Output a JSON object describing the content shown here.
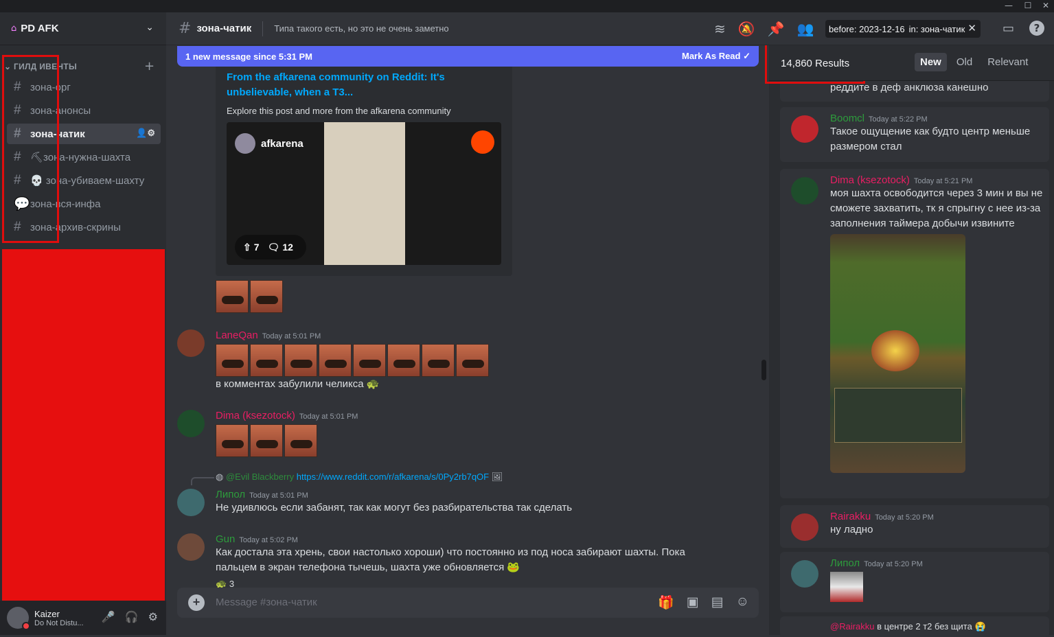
{
  "server": {
    "name": "PD AFK"
  },
  "category": {
    "label": "ГИЛД ИВЕНТЫ"
  },
  "channels": [
    {
      "label": "зона-орг"
    },
    {
      "label": "зона-анонсы"
    },
    {
      "label": "зона-чатик"
    },
    {
      "label": "⛏зона-нужна-шахта"
    },
    {
      "label": "💀 зона-убиваем-шахту"
    },
    {
      "label": "зона-вся-инфа"
    },
    {
      "label": "зона-архив-скрины"
    }
  ],
  "user": {
    "name": "Kaizer",
    "status": "Do Not Distu..."
  },
  "header": {
    "channel": "зона-чатик",
    "topic": "Типа такого есть, но это не очень заметно"
  },
  "search": {
    "token1": "before: 2023-12-16",
    "token2": "in: зона-чатик"
  },
  "new_messages": {
    "text": "1 new message since 5:31 PM",
    "action": "Mark As Read"
  },
  "embed": {
    "title": "From the afkarena community on Reddit: It's unbelievable, when a T3...",
    "description": "Explore this post and more from the afkarena community",
    "subreddit": "afkarena",
    "upvotes": "7",
    "comments": "12"
  },
  "messages": [
    {
      "author": "LaneQan",
      "time": "Today at 5:01 PM",
      "text": "в комментах забулили челикса 🐢",
      "color": "#e91e63"
    },
    {
      "author": "Dima (ksezotock)",
      "time": "Today at 5:01 PM",
      "text": "",
      "color": "#e91e63"
    },
    {
      "reply_author": "@Evil Blackberry",
      "reply_link": "https://www.reddit.com/r/afkarena/s/0Py2rb7qOF",
      "author": "Липол",
      "time": "Today at 5:01 PM",
      "text": "Не удивлюсь если забанят, так как могут без разбирательства так сделать",
      "color": "#2d9c3c"
    },
    {
      "author": "Gun",
      "time": "Today at 5:02 PM",
      "text": "Как достала эта хрень, свои настолько хороши) что постоянно из под носа забирают шахты. Пока пальцем в экран телефона тычешь, шахта уже обновляется 🐸",
      "color": "#2d9c3c"
    }
  ],
  "reaction": {
    "count": "3"
  },
  "composer": {
    "placeholder": "Message #зона-чатик"
  },
  "results": {
    "count": "14,860 Results",
    "tabs": [
      "New",
      "Old",
      "Relevant"
    ],
    "partial_text": "реддите в деф анклюза канешно",
    "items": [
      {
        "author": "Boomcl",
        "time": "Today at 5:22 PM",
        "text": "Такое ощущение как будто центр меньше размером стал",
        "color": "#2d9c3c"
      },
      {
        "author": "Dima (ksezotock)",
        "time": "Today at 5:21 PM",
        "text": "моя шахта освободится через 3 мин и вы не сможете захватить, тк я спрыгну с нее из-за заполнения таймера добычи извините",
        "color": "#e91e63"
      },
      {
        "author": "Rairakku",
        "time": "Today at 5:20 PM",
        "text": "ну ладно",
        "color": "#e91e63"
      },
      {
        "author": "Липол",
        "time": "Today at 5:20 PM",
        "text": "",
        "color": "#2d9c3c"
      }
    ],
    "last_reply": {
      "mention": "@Rairakku",
      "text": "в центре 2 т2 без щита 😭"
    }
  },
  "colors": {
    "accent": "#5865f2",
    "redaction": "#e60f0f",
    "link": "#00a8fc"
  }
}
